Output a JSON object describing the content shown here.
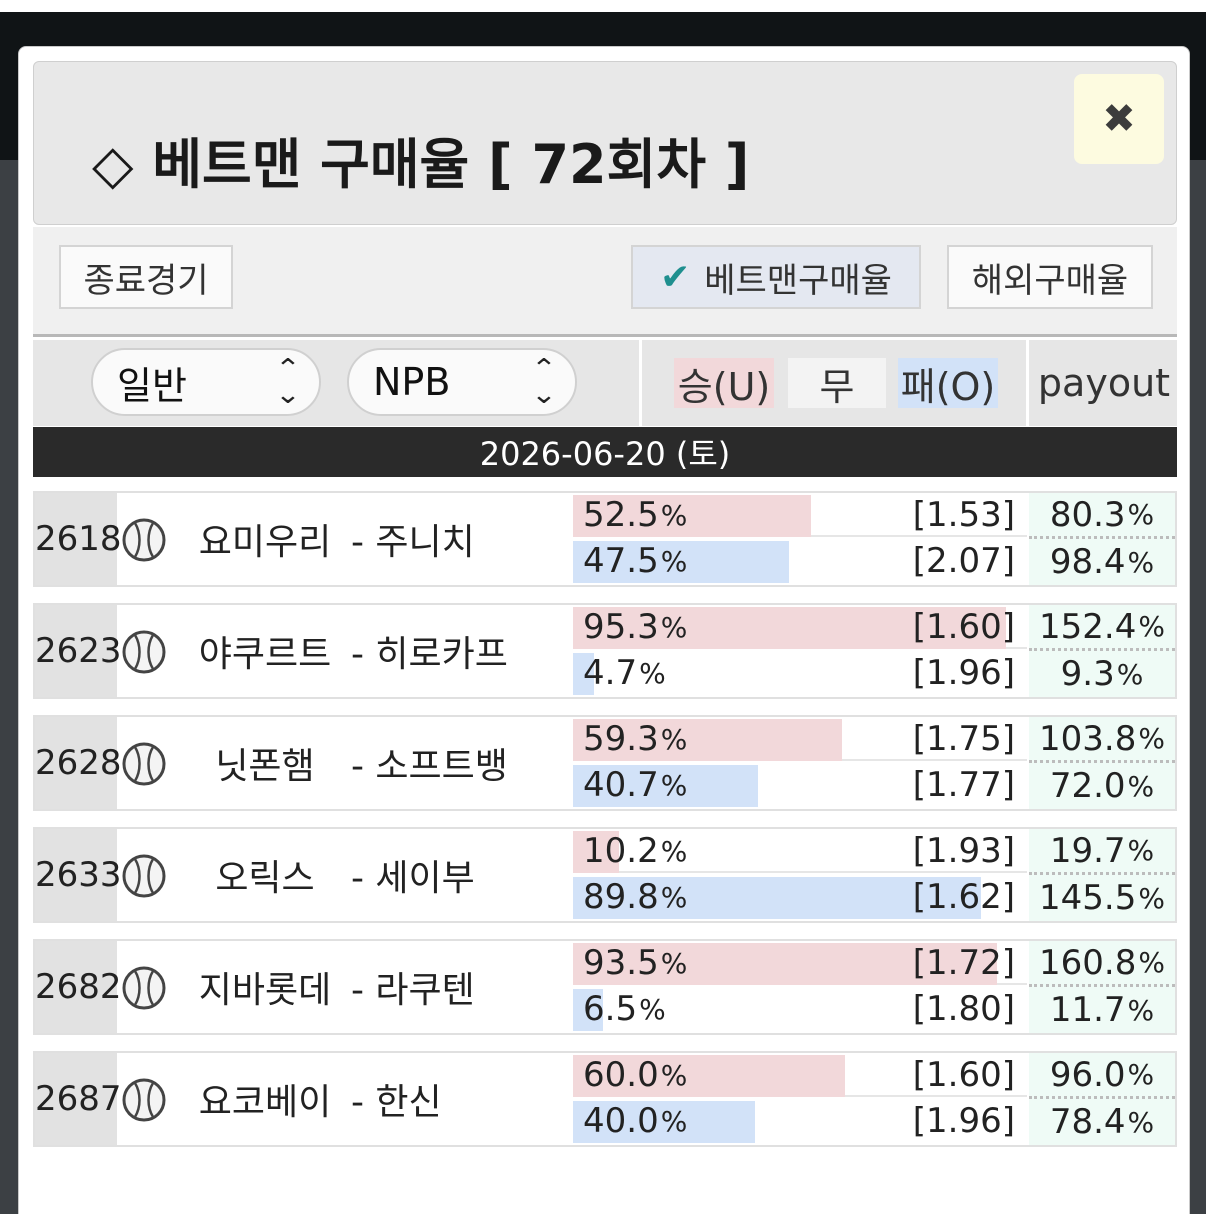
{
  "modal": {
    "title": "◇ 베트맨 구매율 [ 72회차 ]",
    "close_icon": "✖"
  },
  "toolbar": {
    "finished_label": "종료경기",
    "betman_label": "베트맨구매율",
    "betman_check": "✔",
    "overseas_label": "해외구매율"
  },
  "filters": {
    "type_value": "일반",
    "league_value": "NPB",
    "chevron": "⌃⌄"
  },
  "columns": {
    "win": "승(U)",
    "draw": "무",
    "lose": "패(O)",
    "payout": "payout"
  },
  "date": "2026-06-20 (토)",
  "games": [
    {
      "no": "2618",
      "home": "요미우리",
      "away": "- 주니치",
      "win_pct": "52.5",
      "win_fill": 52.5,
      "win_odds": "[1.53]",
      "lose_pct": "47.5",
      "lose_fill": 47.5,
      "lose_odds": "[2.07]",
      "pay_win": "80.3",
      "pay_lose": "98.4"
    },
    {
      "no": "2623",
      "home": "야쿠르트",
      "away": "- 히로카프",
      "win_pct": "95.3",
      "win_fill": 95.3,
      "win_odds": "[1.60]",
      "lose_pct": "4.7",
      "lose_fill": 4.7,
      "lose_odds": "[1.96]",
      "pay_win": "152.4",
      "pay_lose": "9.3"
    },
    {
      "no": "2628",
      "home": "닛폰햄",
      "away": "- 소프트뱅",
      "win_pct": "59.3",
      "win_fill": 59.3,
      "win_odds": "[1.75]",
      "lose_pct": "40.7",
      "lose_fill": 40.7,
      "lose_odds": "[1.77]",
      "pay_win": "103.8",
      "pay_lose": "72.0"
    },
    {
      "no": "2633",
      "home": "오릭스",
      "away": "- 세이부",
      "win_pct": "10.2",
      "win_fill": 10.2,
      "win_odds": "[1.93]",
      "lose_pct": "89.8",
      "lose_fill": 89.8,
      "lose_odds": "[1.62]",
      "pay_win": "19.7",
      "pay_lose": "145.5"
    },
    {
      "no": "2682",
      "home": "지바롯데",
      "away": "- 라쿠텐",
      "win_pct": "93.5",
      "win_fill": 93.5,
      "win_odds": "[1.72]",
      "lose_pct": "6.5",
      "lose_fill": 6.5,
      "lose_odds": "[1.80]",
      "pay_win": "160.8",
      "pay_lose": "11.7"
    },
    {
      "no": "2687",
      "home": "요코베이",
      "away": "- 한신",
      "win_pct": "60.0",
      "win_fill": 60.0,
      "win_odds": "[1.60]",
      "lose_pct": "40.0",
      "lose_fill": 40.0,
      "lose_odds": "[1.96]",
      "pay_win": "96.0",
      "pay_lose": "78.4"
    }
  ],
  "percent_sign": "%",
  "colors": {
    "win_fill": "#f2d8da",
    "lose_fill": "#d2e2f8",
    "payout_bg": "#effbf6"
  },
  "icons": {
    "sport": "baseball-icon"
  }
}
